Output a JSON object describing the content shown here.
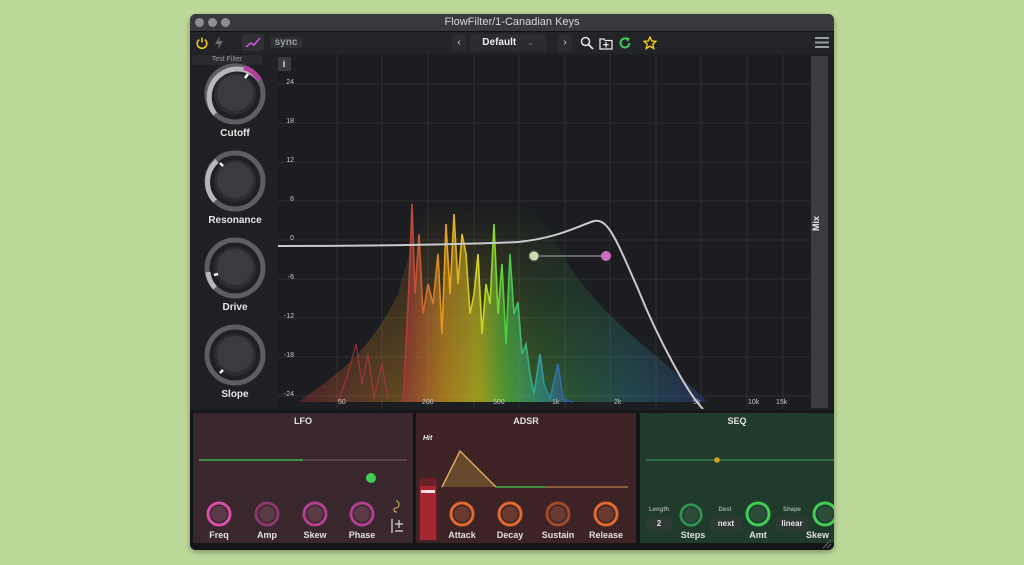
{
  "window": {
    "title": "FlowFilter/1-Canadian Keys"
  },
  "toolbar": {
    "sync_label": "sync",
    "preset_name": "Default",
    "prev_arrow": "‹",
    "next_arrow": "›",
    "dropdown_arrow": "⌄",
    "info_label": "i",
    "icons": [
      "power-icon",
      "lightning-icon",
      "curve-icon",
      "search-icon",
      "add-preset-icon",
      "refresh-icon",
      "star-icon",
      "menu-icon"
    ]
  },
  "left_panel": {
    "test_label": "Test Filter",
    "knobs": [
      {
        "label": "Cutoff"
      },
      {
        "label": "Resonance"
      },
      {
        "label": "Drive"
      },
      {
        "label": "Slope"
      }
    ]
  },
  "graph": {
    "db_labels": [
      "24",
      "18",
      "12",
      "6",
      "0",
      "-6",
      "-12",
      "-18",
      "-24"
    ],
    "freq_labels": [
      "50",
      "200",
      "500",
      "1k",
      "2k",
      "5k",
      "10k",
      "15k"
    ],
    "mix_label": "Mix"
  },
  "lfo": {
    "title": "LFO",
    "knobs": [
      "Freq",
      "Amp",
      "Skew",
      "Phase"
    ]
  },
  "adsr": {
    "title": "ADSR",
    "hit_label": "Hit",
    "knobs": [
      "Attack",
      "Decay",
      "Sustain",
      "Release"
    ]
  },
  "seq": {
    "title": "SEQ",
    "length_label": "Length",
    "length_value": "2",
    "steps_label": "Steps",
    "dest_label": "Dest",
    "dest_value": "next",
    "amt_label": "Amt",
    "shape_label": "Shape",
    "shape_value": "linear",
    "skew_label": "Skew"
  },
  "colors": {
    "accent_pink": "#d06bc2",
    "accent_green": "#3fcf54",
    "accent_yellow": "#ffd21a",
    "lfo_bg": "#3a262d",
    "adsr_bg": "#3d2226",
    "seq_bg": "#203a2c"
  }
}
